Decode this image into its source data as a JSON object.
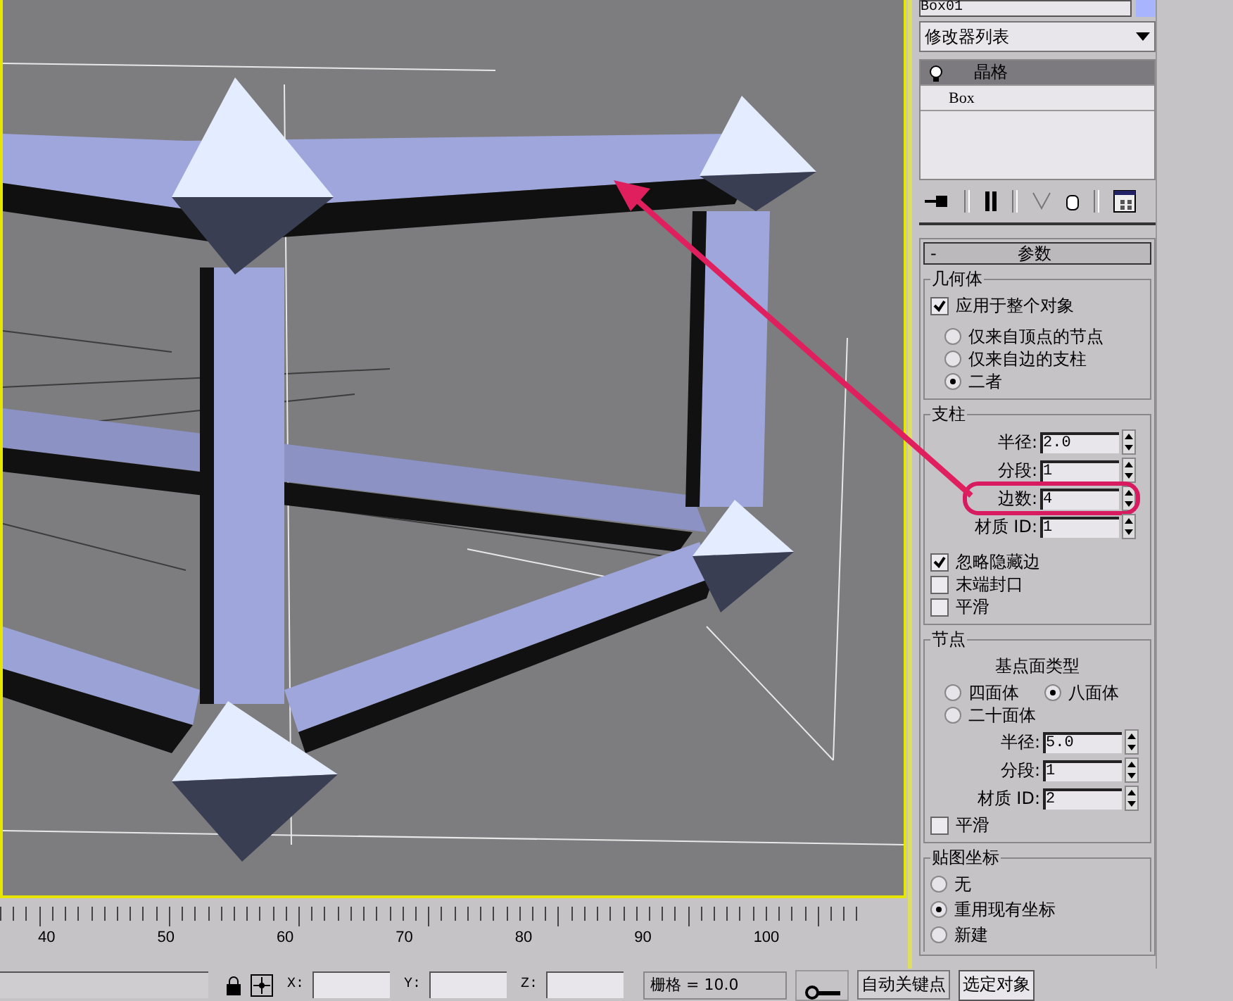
{
  "object_name": "Box01",
  "modifier_list": {
    "label": "修改器列表"
  },
  "modifier_stack": [
    {
      "label": "晶格",
      "selected": true
    },
    {
      "label": "Box",
      "selected": false
    }
  ],
  "parameters_rollout": {
    "collapse_sign": "-",
    "title": "参数"
  },
  "geometry": {
    "title": "几何体",
    "apply_to_whole": {
      "label": "应用于整个对象",
      "checked": true
    },
    "options": [
      {
        "label": "仅来自顶点的节点",
        "selected": false
      },
      {
        "label": "仅来自边的支柱",
        "selected": false
      },
      {
        "label": "二者",
        "selected": true
      }
    ]
  },
  "struts": {
    "title": "支柱",
    "fields": [
      {
        "label": "半径:",
        "value": "2.0",
        "highlighted": false
      },
      {
        "label": "分段:",
        "value": "1",
        "highlighted": false
      },
      {
        "label": "边数:",
        "value": "4",
        "highlighted": true
      },
      {
        "label": "材质 ID:",
        "value": "1",
        "highlighted": false
      }
    ],
    "checkboxes": [
      {
        "label": "忽略隐藏边",
        "checked": true
      },
      {
        "label": "末端封口",
        "checked": false
      },
      {
        "label": "平滑",
        "checked": false
      }
    ]
  },
  "joints": {
    "title": "节点",
    "type_label": "基点面类型",
    "types": [
      {
        "label": "四面体",
        "selected": false
      },
      {
        "label": "八面体",
        "selected": true
      },
      {
        "label": "二十面体",
        "selected": false
      }
    ],
    "fields": [
      {
        "label": "半径:",
        "value": "5.0"
      },
      {
        "label": "分段:",
        "value": "1"
      },
      {
        "label": "材质 ID:",
        "value": "2"
      }
    ],
    "smooth": {
      "label": "平滑",
      "checked": false
    }
  },
  "mapping": {
    "title": "贴图坐标",
    "options": [
      {
        "label": "无",
        "selected": false
      },
      {
        "label": "重用现有坐标",
        "selected": true
      },
      {
        "label": "新建",
        "selected": false
      }
    ]
  },
  "ruler": {
    "ticks": [
      "40",
      "50",
      "60",
      "70",
      "80",
      "90",
      "100"
    ]
  },
  "status_bar": {
    "x_label": "X:",
    "y_label": "Y:",
    "z_label": "Z:",
    "grid": "栅格 = 10.0",
    "auto_key": "自动关键点",
    "selection": "选定对象"
  }
}
